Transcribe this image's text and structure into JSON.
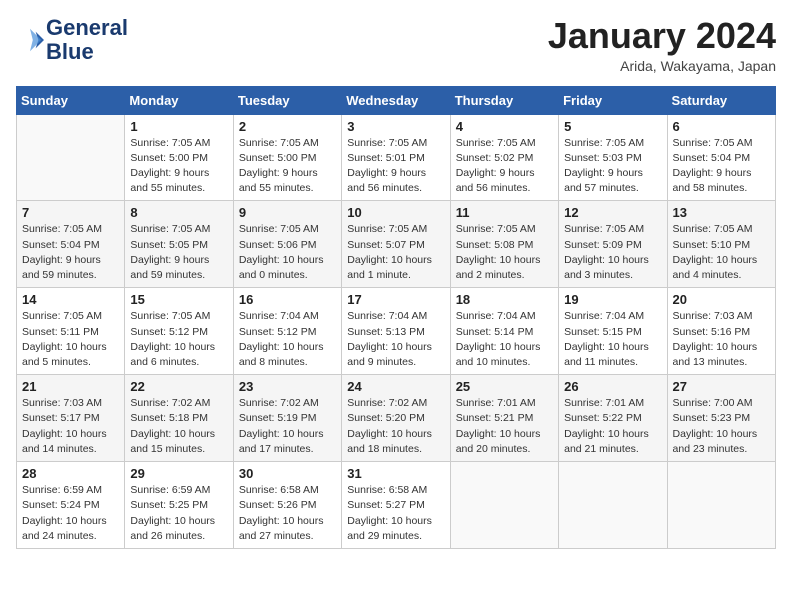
{
  "header": {
    "logo_line1": "General",
    "logo_line2": "Blue",
    "month_title": "January 2024",
    "location": "Arida, Wakayama, Japan"
  },
  "days_of_week": [
    "Sunday",
    "Monday",
    "Tuesday",
    "Wednesday",
    "Thursday",
    "Friday",
    "Saturday"
  ],
  "weeks": [
    [
      {
        "day": "",
        "info": ""
      },
      {
        "day": "1",
        "info": "Sunrise: 7:05 AM\nSunset: 5:00 PM\nDaylight: 9 hours\nand 55 minutes."
      },
      {
        "day": "2",
        "info": "Sunrise: 7:05 AM\nSunset: 5:00 PM\nDaylight: 9 hours\nand 55 minutes."
      },
      {
        "day": "3",
        "info": "Sunrise: 7:05 AM\nSunset: 5:01 PM\nDaylight: 9 hours\nand 56 minutes."
      },
      {
        "day": "4",
        "info": "Sunrise: 7:05 AM\nSunset: 5:02 PM\nDaylight: 9 hours\nand 56 minutes."
      },
      {
        "day": "5",
        "info": "Sunrise: 7:05 AM\nSunset: 5:03 PM\nDaylight: 9 hours\nand 57 minutes."
      },
      {
        "day": "6",
        "info": "Sunrise: 7:05 AM\nSunset: 5:04 PM\nDaylight: 9 hours\nand 58 minutes."
      }
    ],
    [
      {
        "day": "7",
        "info": "Sunrise: 7:05 AM\nSunset: 5:04 PM\nDaylight: 9 hours\nand 59 minutes."
      },
      {
        "day": "8",
        "info": "Sunrise: 7:05 AM\nSunset: 5:05 PM\nDaylight: 9 hours\nand 59 minutes."
      },
      {
        "day": "9",
        "info": "Sunrise: 7:05 AM\nSunset: 5:06 PM\nDaylight: 10 hours\nand 0 minutes."
      },
      {
        "day": "10",
        "info": "Sunrise: 7:05 AM\nSunset: 5:07 PM\nDaylight: 10 hours\nand 1 minute."
      },
      {
        "day": "11",
        "info": "Sunrise: 7:05 AM\nSunset: 5:08 PM\nDaylight: 10 hours\nand 2 minutes."
      },
      {
        "day": "12",
        "info": "Sunrise: 7:05 AM\nSunset: 5:09 PM\nDaylight: 10 hours\nand 3 minutes."
      },
      {
        "day": "13",
        "info": "Sunrise: 7:05 AM\nSunset: 5:10 PM\nDaylight: 10 hours\nand 4 minutes."
      }
    ],
    [
      {
        "day": "14",
        "info": "Sunrise: 7:05 AM\nSunset: 5:11 PM\nDaylight: 10 hours\nand 5 minutes."
      },
      {
        "day": "15",
        "info": "Sunrise: 7:05 AM\nSunset: 5:12 PM\nDaylight: 10 hours\nand 6 minutes."
      },
      {
        "day": "16",
        "info": "Sunrise: 7:04 AM\nSunset: 5:12 PM\nDaylight: 10 hours\nand 8 minutes."
      },
      {
        "day": "17",
        "info": "Sunrise: 7:04 AM\nSunset: 5:13 PM\nDaylight: 10 hours\nand 9 minutes."
      },
      {
        "day": "18",
        "info": "Sunrise: 7:04 AM\nSunset: 5:14 PM\nDaylight: 10 hours\nand 10 minutes."
      },
      {
        "day": "19",
        "info": "Sunrise: 7:04 AM\nSunset: 5:15 PM\nDaylight: 10 hours\nand 11 minutes."
      },
      {
        "day": "20",
        "info": "Sunrise: 7:03 AM\nSunset: 5:16 PM\nDaylight: 10 hours\nand 13 minutes."
      }
    ],
    [
      {
        "day": "21",
        "info": "Sunrise: 7:03 AM\nSunset: 5:17 PM\nDaylight: 10 hours\nand 14 minutes."
      },
      {
        "day": "22",
        "info": "Sunrise: 7:02 AM\nSunset: 5:18 PM\nDaylight: 10 hours\nand 15 minutes."
      },
      {
        "day": "23",
        "info": "Sunrise: 7:02 AM\nSunset: 5:19 PM\nDaylight: 10 hours\nand 17 minutes."
      },
      {
        "day": "24",
        "info": "Sunrise: 7:02 AM\nSunset: 5:20 PM\nDaylight: 10 hours\nand 18 minutes."
      },
      {
        "day": "25",
        "info": "Sunrise: 7:01 AM\nSunset: 5:21 PM\nDaylight: 10 hours\nand 20 minutes."
      },
      {
        "day": "26",
        "info": "Sunrise: 7:01 AM\nSunset: 5:22 PM\nDaylight: 10 hours\nand 21 minutes."
      },
      {
        "day": "27",
        "info": "Sunrise: 7:00 AM\nSunset: 5:23 PM\nDaylight: 10 hours\nand 23 minutes."
      }
    ],
    [
      {
        "day": "28",
        "info": "Sunrise: 6:59 AM\nSunset: 5:24 PM\nDaylight: 10 hours\nand 24 minutes."
      },
      {
        "day": "29",
        "info": "Sunrise: 6:59 AM\nSunset: 5:25 PM\nDaylight: 10 hours\nand 26 minutes."
      },
      {
        "day": "30",
        "info": "Sunrise: 6:58 AM\nSunset: 5:26 PM\nDaylight: 10 hours\nand 27 minutes."
      },
      {
        "day": "31",
        "info": "Sunrise: 6:58 AM\nSunset: 5:27 PM\nDaylight: 10 hours\nand 29 minutes."
      },
      {
        "day": "",
        "info": ""
      },
      {
        "day": "",
        "info": ""
      },
      {
        "day": "",
        "info": ""
      }
    ]
  ]
}
